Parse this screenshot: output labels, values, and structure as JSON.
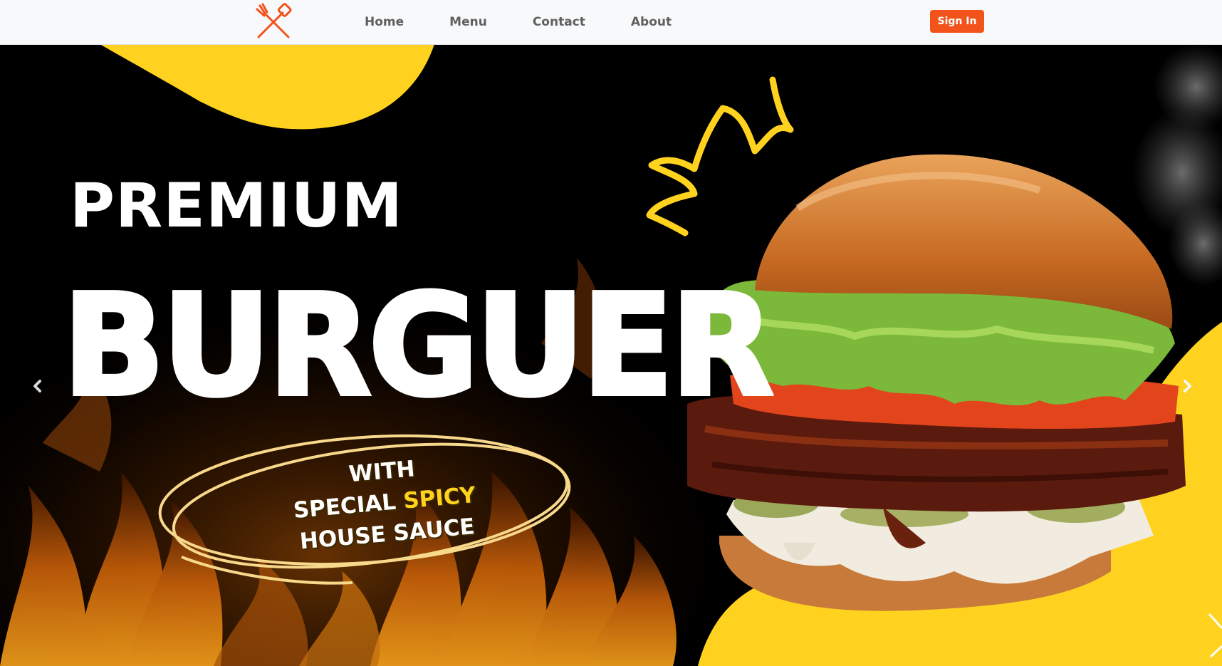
{
  "colors": {
    "accent": "#f2531b",
    "yellow": "#ffd21f",
    "flame": "#f08a12",
    "nav_text": "#5f5f5f"
  },
  "header": {
    "logo_icon": "crossed-fork-spatula-icon",
    "nav": [
      "Home",
      "Menu",
      "Contact",
      "About"
    ],
    "sign_in_label": "Sign In"
  },
  "hero": {
    "line1": "PREMIUM",
    "line2": "BURGUER",
    "tagline": {
      "line1": "WITH",
      "line2_prefix": "SPECIAL ",
      "line2_accent": "SPICY",
      "line3": "HOUSE SAUCE"
    },
    "prev_icon": "chevron-left-icon",
    "next_icon": "chevron-right-icon"
  }
}
